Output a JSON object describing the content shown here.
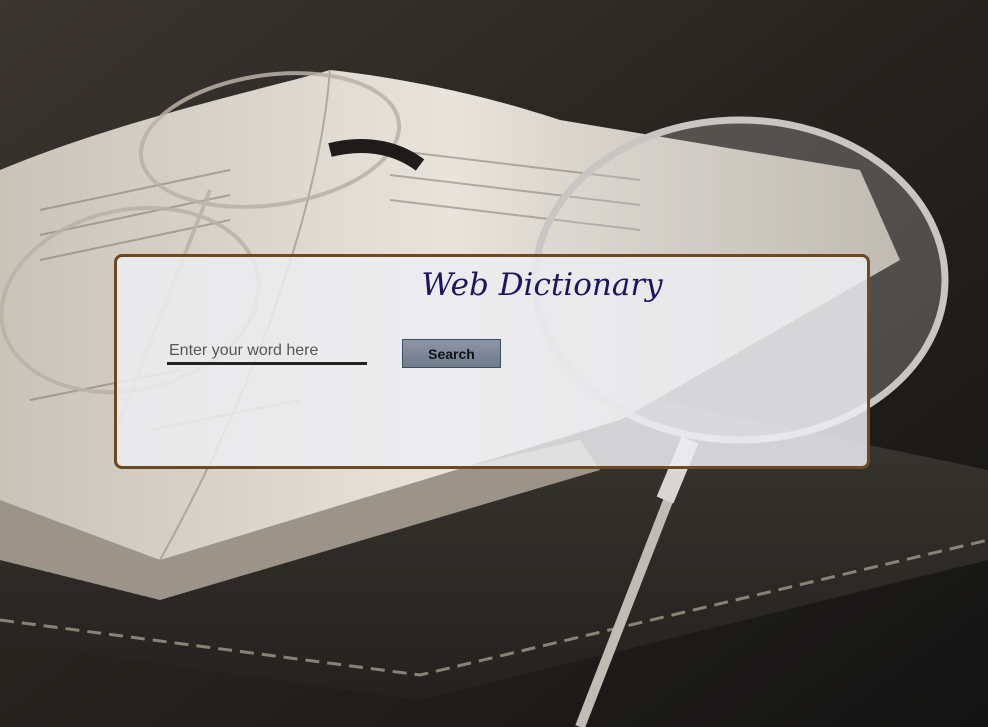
{
  "header": {
    "title": "Web Dictionary"
  },
  "search": {
    "placeholder": "Enter your word here",
    "value": "",
    "button_label": "Search"
  },
  "colors": {
    "title": "#1c1660",
    "card_border": "#6b4a22",
    "button_bg": "#7b8697"
  }
}
